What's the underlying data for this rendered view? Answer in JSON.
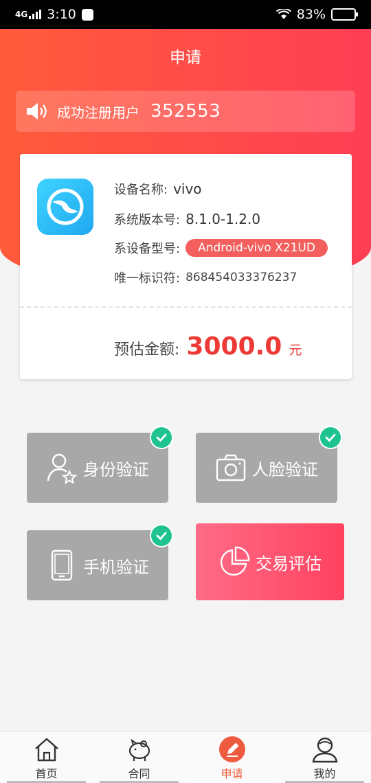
{
  "status": {
    "time": "3:10",
    "network": "4G",
    "battery": "83%"
  },
  "header": {
    "title": "申请"
  },
  "notice": {
    "label": "成功注册用户",
    "count": "352553"
  },
  "device": {
    "name_label": "设备名称:",
    "name_value": "vivo",
    "version_label": "系统版本号:",
    "version_value": "8.1.0-1.2.0",
    "model_label": "系设备型号:",
    "model_value": "Android-vivo X21UD",
    "id_label": "唯一标识符:",
    "id_value": "868454033376237",
    "amount_label": "预估金额:",
    "amount_value": "3000.0",
    "amount_unit": "元"
  },
  "tiles": [
    {
      "label": "身份验证",
      "icon": "user-star-icon",
      "verified": true
    },
    {
      "label": "人脸验证",
      "icon": "camera-icon",
      "verified": true
    },
    {
      "label": "手机验证",
      "icon": "phone-icon",
      "verified": true
    },
    {
      "label": "交易评估",
      "icon": "pie-chart-icon",
      "verified": false
    }
  ],
  "tabbar": [
    {
      "label": "首页",
      "icon": "home-icon"
    },
    {
      "label": "合同",
      "icon": "piggy-bank-icon"
    },
    {
      "label": "申请",
      "icon": "edit-icon",
      "active": true
    },
    {
      "label": "我的",
      "icon": "person-icon"
    }
  ],
  "colors": {
    "accent": "#ff4a48",
    "amount": "#ee3a36",
    "verified": "#1fc38f",
    "tile_disabled": "#a8a8a8"
  }
}
